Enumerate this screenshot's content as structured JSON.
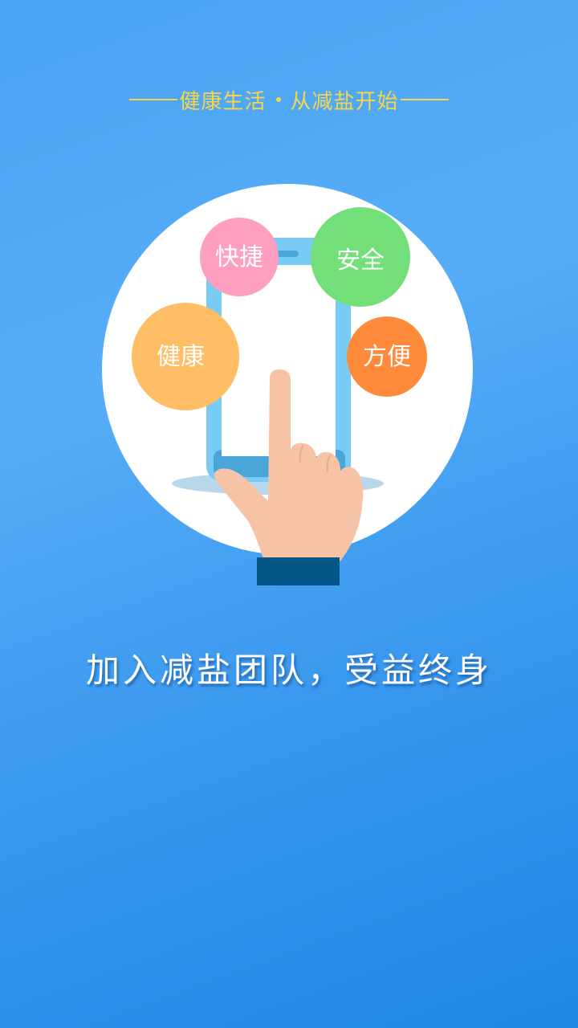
{
  "tagline": {
    "part1": "健康生活",
    "part2": "从减盐开始"
  },
  "bubbles": {
    "kuaijie": "快捷",
    "anquan": "安全",
    "jiankang": "健康",
    "fangbian": "方便"
  },
  "slogan": "加入减盐团队，受益终身",
  "colors": {
    "background": "#3a98ee",
    "tagline": "#f7d548",
    "bubble_kuaijie": "#ff9fbf",
    "bubble_anquan": "#72df79",
    "bubble_jiankang": "#ffbd66",
    "bubble_fangbian": "#ff8a3a",
    "phone": "#78cbf5",
    "hand": "#f6c3a7",
    "sleeve": "#045786"
  },
  "icons": {
    "illustration": "hand-tapping-phone-icon"
  }
}
